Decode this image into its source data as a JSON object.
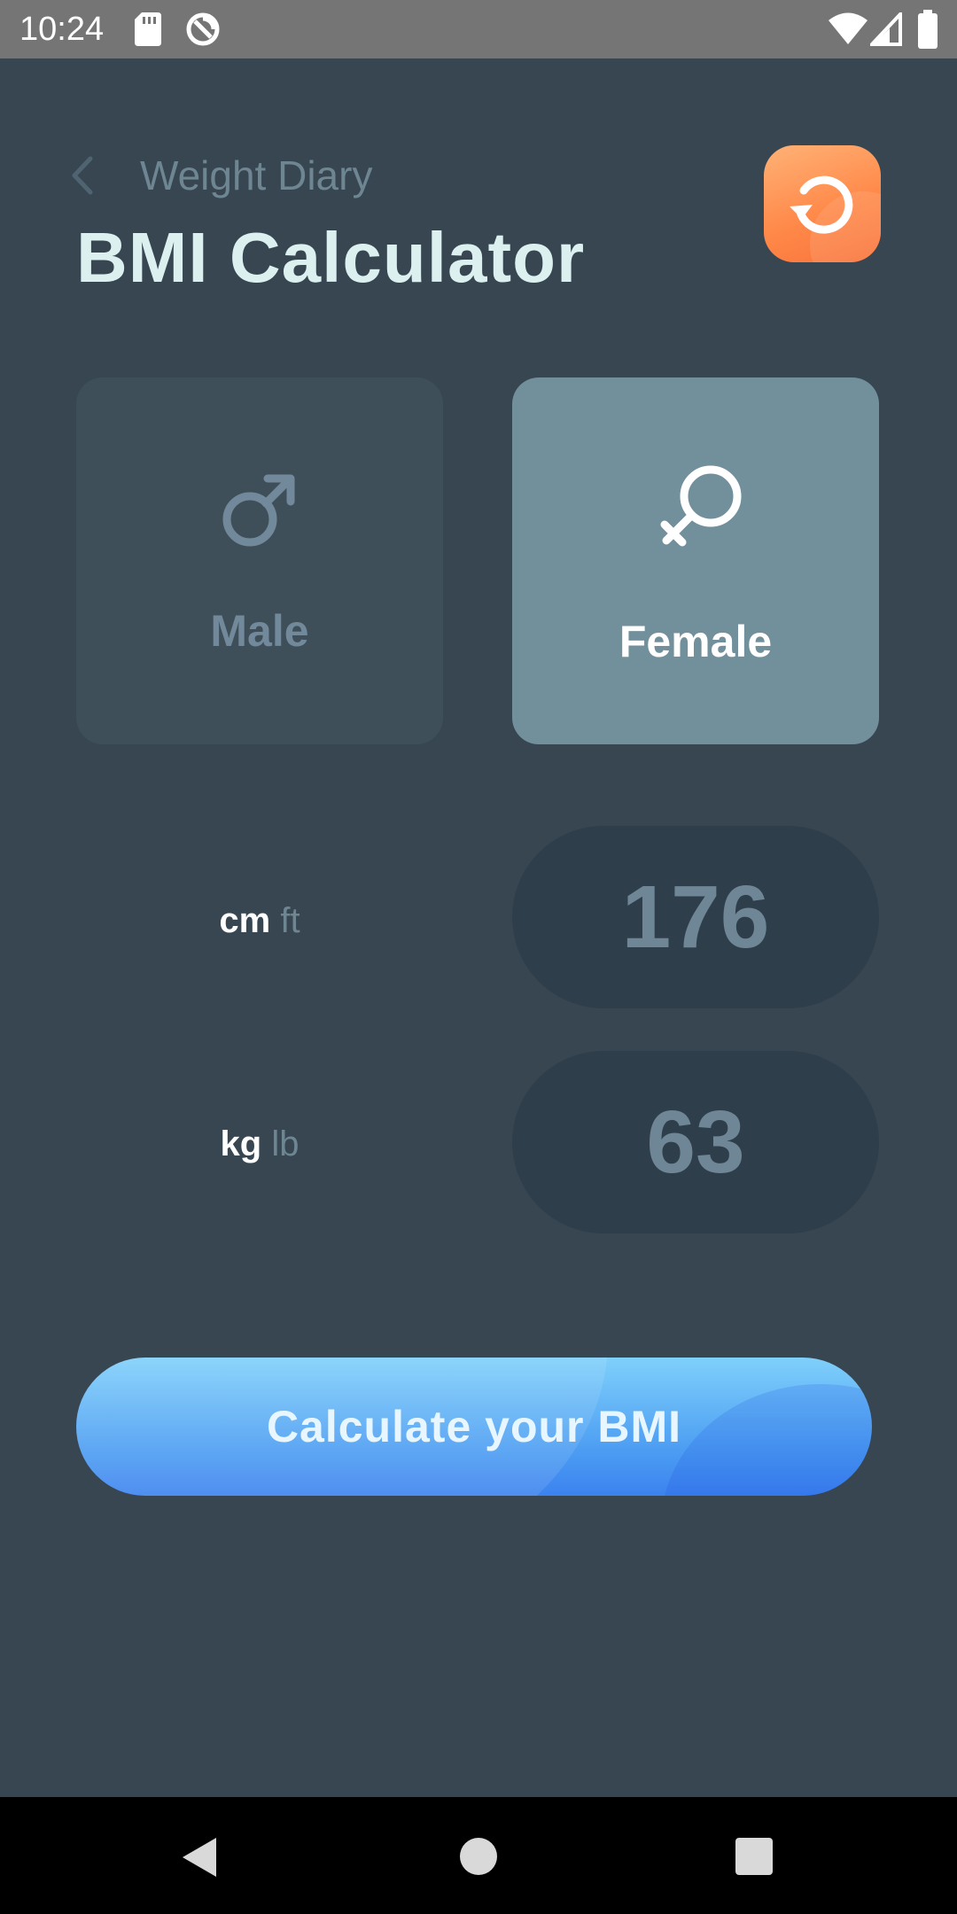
{
  "status_bar": {
    "time": "10:24",
    "icons": [
      "sd-card-icon",
      "sync-icon",
      "wifi-icon",
      "signal-icon",
      "battery-icon"
    ]
  },
  "header": {
    "back_label": "Weight Diary",
    "title_bold": "BMI",
    "title_rest": " Calculator",
    "reset_icon": "reset-icon"
  },
  "gender": {
    "male_label": "Male",
    "female_label": "Female",
    "selected": "Female"
  },
  "height": {
    "unit_active": "cm",
    "unit_inactive": " ft",
    "value": "176"
  },
  "weight": {
    "unit_active": "kg",
    "unit_inactive": " lb",
    "value": "63"
  },
  "calculate": {
    "label": "Calculate your BMI"
  },
  "nav_bar": {
    "icons": [
      "nav-back-icon",
      "nav-home-icon",
      "nav-recents-icon"
    ]
  },
  "colors": {
    "background": "#374651",
    "accent_orange": "#ff8a4a",
    "accent_blue": "#4a9bf2",
    "selected_card": "#728f9c"
  }
}
